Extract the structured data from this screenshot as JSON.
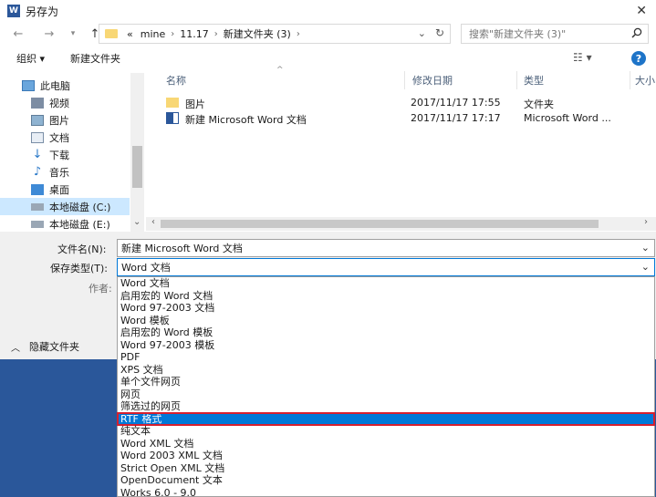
{
  "window": {
    "title": "另存为",
    "app_badge": "W"
  },
  "address": {
    "crumbs": [
      "mine",
      "11.17",
      "新建文件夹 (3)"
    ],
    "overflow": "«",
    "search_placeholder": "搜索\"新建文件夹 (3)\""
  },
  "toolbar": {
    "organize": "组织 ▾",
    "new_folder": "新建文件夹"
  },
  "nav": {
    "items": [
      {
        "label": "此电脑",
        "icon": "computer-icon"
      },
      {
        "label": "视频",
        "icon": "video-icon"
      },
      {
        "label": "图片",
        "icon": "pictures-icon"
      },
      {
        "label": "文档",
        "icon": "documents-icon"
      },
      {
        "label": "下载",
        "icon": "download-icon"
      },
      {
        "label": "音乐",
        "icon": "music-icon"
      },
      {
        "label": "桌面",
        "icon": "desktop-icon"
      },
      {
        "label": "本地磁盘 (C:)",
        "icon": "drive-icon"
      },
      {
        "label": "本地磁盘 (E:)",
        "icon": "drive-icon"
      }
    ]
  },
  "columns": {
    "name": "名称",
    "date": "修改日期",
    "type": "类型",
    "size": "大小"
  },
  "files": [
    {
      "name": "图片",
      "date": "2017/11/17 17:55",
      "type": "文件夹",
      "icon": "folder-icon"
    },
    {
      "name": "新建 Microsoft Word 文档",
      "date": "2017/11/17 17:17",
      "type": "Microsoft Word ...",
      "icon": "word-doc-icon"
    }
  ],
  "form": {
    "filename_label": "文件名(N):",
    "filename_value": "新建 Microsoft Word 文档",
    "savetype_label": "保存类型(T):",
    "savetype_value": "Word 文档",
    "author_label": "作者:",
    "hide_folders": "隐藏文件夹"
  },
  "save_types": [
    "Word 文档",
    "启用宏的 Word 文档",
    "Word 97-2003 文档",
    "Word 模板",
    "启用宏的 Word 模板",
    "Word 97-2003 模板",
    "PDF",
    "XPS 文档",
    "单个文件网页",
    "网页",
    "筛选过的网页",
    "RTF 格式",
    "纯文本",
    "Word XML 文档",
    "Word 2003 XML 文档",
    "Strict Open XML 文档",
    "OpenDocument 文本",
    "Works 6.0 - 9.0"
  ],
  "highlighted_type": "RTF 格式",
  "colors": {
    "accent": "#0078d7",
    "highlight_border": "#d6202e",
    "backdrop": "#2a579a"
  }
}
